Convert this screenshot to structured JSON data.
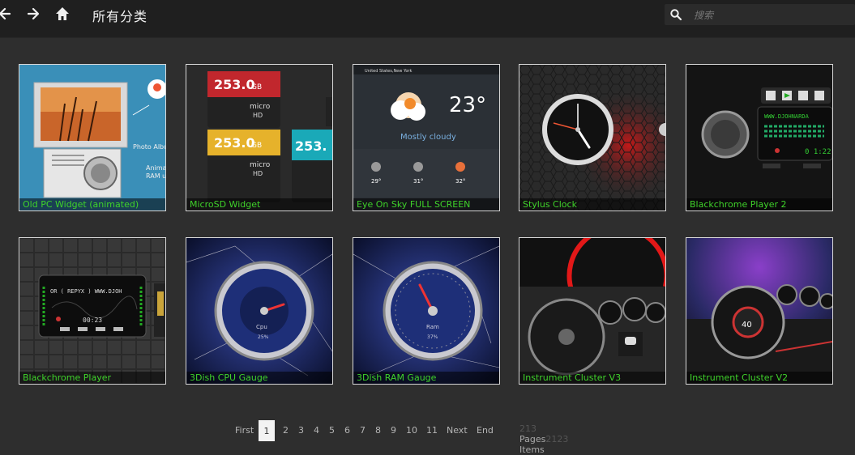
{
  "header": {
    "title": "所有分类",
    "search_placeholder": "搜索"
  },
  "tiles": [
    {
      "label": "Old PC Widget (animated)"
    },
    {
      "label": "MicroSD Widget"
    },
    {
      "label": "Eye On Sky FULL SCREEN"
    },
    {
      "label": "Stylus Clock"
    },
    {
      "label": "Blackchrome Player 2"
    },
    {
      "label": "Blackchrome Player"
    },
    {
      "label": "3Dish CPU Gauge"
    },
    {
      "label": "3Dish RAM Gauge"
    },
    {
      "label": "Instrument Cluster V3"
    },
    {
      "label": "Instrument Cluster V2"
    }
  ],
  "thumb_text": {
    "photo_album": "Photo Album",
    "animated": "Animat",
    "ram": "RAM u",
    "sd_size": "253.0",
    "sd_unit": "GB",
    "sd_brand": "micro",
    "sd_hc": "HD",
    "sd_partial": "253.",
    "weather_location": "United States,New York",
    "weather_temp": "23°",
    "weather_desc": "Mostly cloudy",
    "weather_days": [
      "29°",
      "31°",
      "32°"
    ],
    "player_url": "WWW.DJOHNARDA",
    "player_time": "0 1:22",
    "player_text": "OR ( REPYX ) WWW.DJOH",
    "player_time2": "00:23",
    "cpu_label": "Cpu",
    "cpu_value": "25%",
    "ram_label": "Ram",
    "ram_value": "37%",
    "cluster_speed": "40"
  },
  "pagination": {
    "first": "First",
    "current": "1",
    "pages": [
      "2",
      "3",
      "4",
      "5",
      "6",
      "7",
      "8",
      "9",
      "10",
      "11"
    ],
    "next": "Next",
    "end": "End",
    "total_pages": "213",
    "pages_word": "Pages",
    "total_items": "2123",
    "items_word": "Items"
  }
}
